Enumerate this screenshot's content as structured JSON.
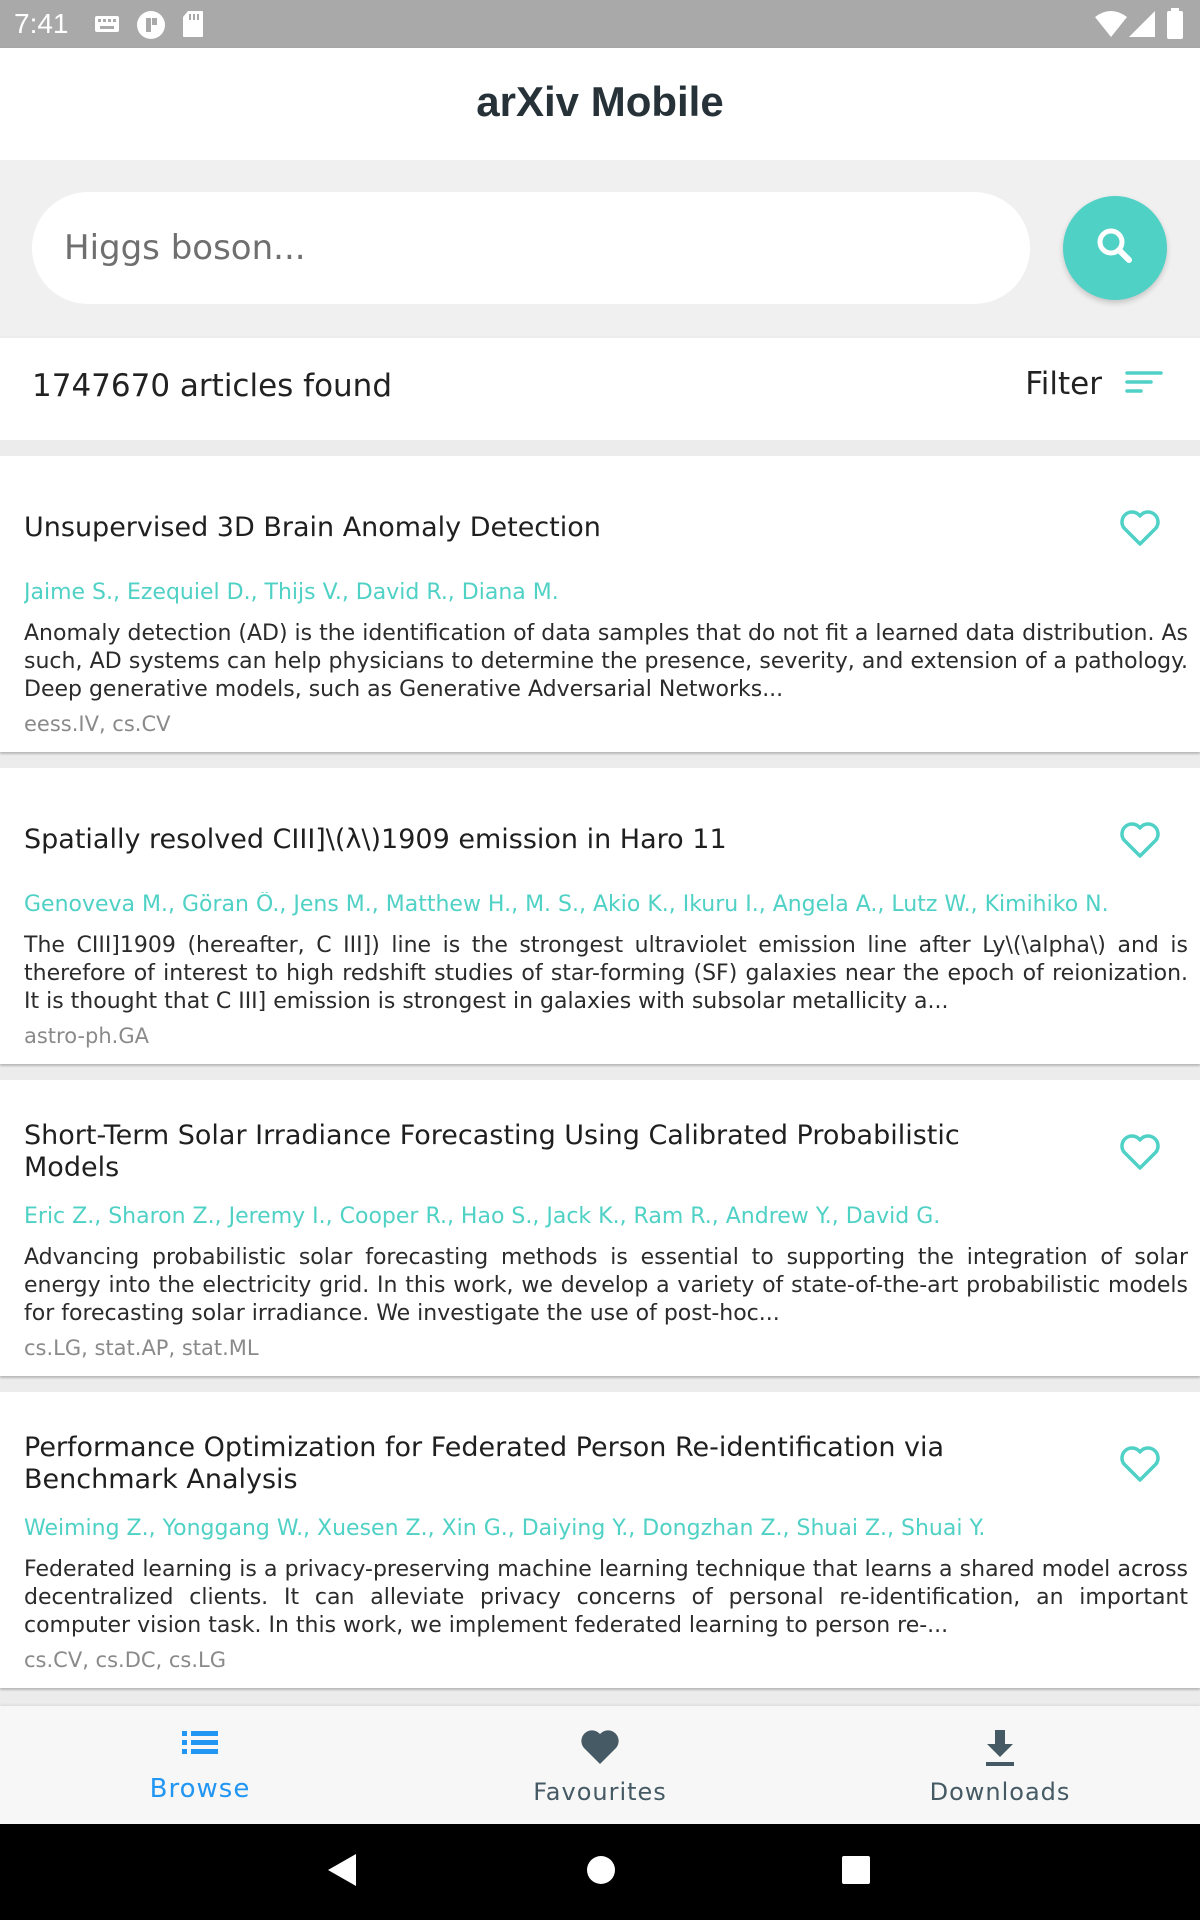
{
  "status_bar": {
    "time": "7:41",
    "icons": [
      "keyboard-icon",
      "app-notification-icon",
      "sd-card-icon",
      "wifi-icon",
      "signal-icon",
      "battery-icon"
    ]
  },
  "app_bar": {
    "title": "arXiv Mobile"
  },
  "search": {
    "placeholder": "Higgs boson..."
  },
  "results": {
    "count_text": "1747670 articles found",
    "filter_label": "Filter"
  },
  "colors": {
    "accent": "#4fd1c5",
    "active_nav": "#2196f3",
    "inactive_nav": "#455a64",
    "title": "#263238"
  },
  "articles": [
    {
      "title": "Unsupervised 3D Brain Anomaly Detection",
      "authors": "Jaime S., Ezequiel D., Thijs V., David R., Diana M.",
      "abstract": "Anomaly detection (AD) is the identification of data samples that do not fit a learned data distribution. As such, AD systems can help physicians to determine the presence, severity, and extension of a pathology. Deep generative models, such as Generative Adversarial Networks...",
      "categories": "eess.IV, cs.CV"
    },
    {
      "title": "Spatially resolved CIII]\\(λ\\)1909 emission in Haro 11",
      "authors": "Genoveva M., Göran Ö., Jens M., Matthew H., M. S., Akio K., Ikuru I., Angela A., Lutz W., Kimihiko N.",
      "abstract": "The CIII]1909 (hereafter, C III]) line is the strongest ultraviolet emission line after Ly\\(\\alpha\\) and is therefore of interest to high redshift studies of star-forming (SF) galaxies near the epoch of reionization. It is thought that C III] emission is strongest in galaxies with subsolar metallicity a...",
      "categories": "astro-ph.GA"
    },
    {
      "title": "Short-Term Solar Irradiance Forecasting Using Calibrated Probabilistic Models",
      "authors": "Eric Z., Sharon Z., Jeremy I., Cooper R., Hao S., Jack K., Ram R., Andrew Y., David G.",
      "abstract": "Advancing probabilistic solar forecasting methods is essential to supporting the integration of solar energy into the electricity grid. In this work, we develop a variety of state-of-the-art probabilistic models for forecasting solar irradiance. We investigate the use of post-hoc...",
      "categories": "cs.LG, stat.AP, stat.ML"
    },
    {
      "title": "Performance Optimization for Federated Person Re-identification via Benchmark Analysis",
      "authors": "Weiming Z., Yonggang W., Xuesen Z., Xin G., Daiying Y., Dongzhan Z., Shuai Z., Shuai Y.",
      "abstract": "Federated learning is a privacy-preserving machine learning technique that learns a shared model across decentralized clients. It can alleviate privacy concerns of personal re-identification, an important computer vision task. In this work, we implement federated learning to person re-...",
      "categories": "cs.CV, cs.DC, cs.LG"
    }
  ],
  "bottom_nav": [
    {
      "label": "Browse",
      "icon": "list-icon",
      "active": true
    },
    {
      "label": "Favourites",
      "icon": "heart-icon",
      "active": false
    },
    {
      "label": "Downloads",
      "icon": "download-icon",
      "active": false
    }
  ],
  "system_nav": [
    "back-icon",
    "home-icon",
    "recents-icon"
  ]
}
